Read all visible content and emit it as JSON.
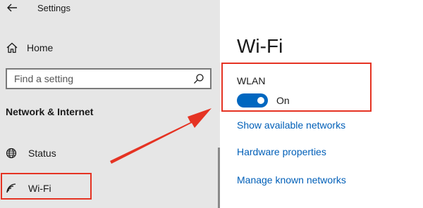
{
  "window": {
    "title": "Settings"
  },
  "sidebar": {
    "home_label": "Home",
    "search": {
      "placeholder": "Find a setting"
    },
    "section_heading": "Network & Internet",
    "items": [
      {
        "label": "Status",
        "icon": "globe-icon"
      },
      {
        "label": "Wi-Fi",
        "icon": "wifi-icon"
      }
    ]
  },
  "main": {
    "title": "Wi-Fi",
    "wlan_label": "WLAN",
    "toggle_state": "On",
    "toggle_on": true,
    "links": [
      "Show available networks",
      "Hardware properties",
      "Manage known networks"
    ]
  },
  "annotation": {
    "highlight_color": "#e53323"
  },
  "colors": {
    "accent": "#0067c0",
    "link": "#005fb8",
    "sidebar_bg": "#e6e6e6"
  }
}
